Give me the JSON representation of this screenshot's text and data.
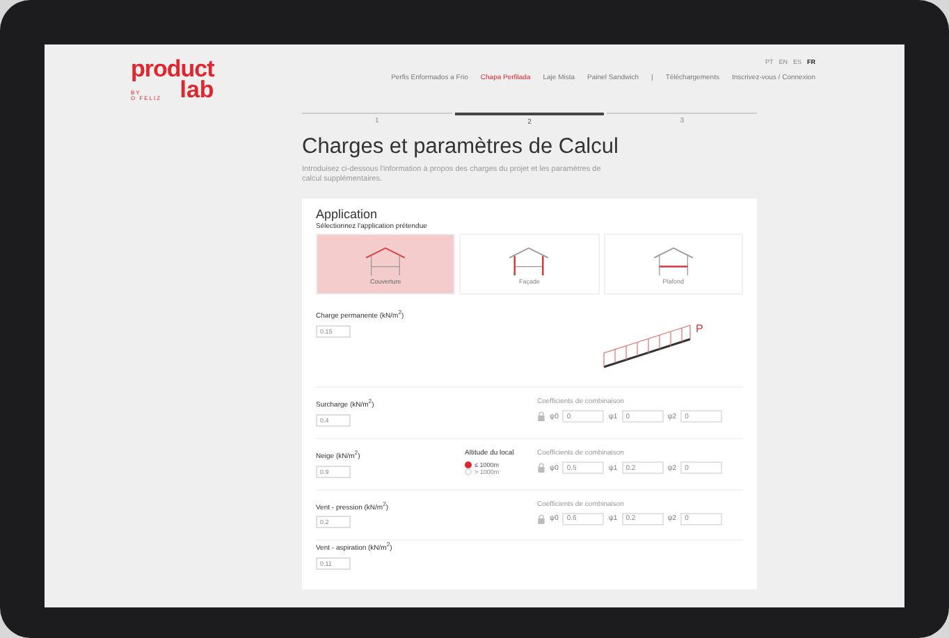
{
  "languages": [
    {
      "label": "PT",
      "selected": false
    },
    {
      "label": "EN",
      "selected": false
    },
    {
      "label": "ES",
      "selected": false
    },
    {
      "label": "FR",
      "selected": true
    }
  ],
  "logo": {
    "top": "product",
    "by": "BY",
    "brand": "O FELIZ",
    "bottom": "lab"
  },
  "nav": [
    {
      "label": "Perfis Enformados a Frio",
      "selected": false
    },
    {
      "label": "Chapa Perfilada",
      "selected": true
    },
    {
      "label": "Laje Mista",
      "selected": false
    },
    {
      "label": "Painel Sandwich",
      "selected": false
    },
    {
      "label": "|",
      "selected": false
    },
    {
      "label": "Téléchargements",
      "selected": false
    },
    {
      "label": "Inscrivez-vous / Connexion",
      "selected": false
    }
  ],
  "steps": [
    {
      "label": "1",
      "selected": false
    },
    {
      "label": "2",
      "selected": true
    },
    {
      "label": "3",
      "selected": false
    }
  ],
  "title": "Charges et paramètres de Calcul",
  "intro": "Introduisez ci-dessous l'information à propos des charges du projet et les paramètres de calcul supplémentaires.",
  "application": {
    "heading": "Application",
    "subheading": "Sélectionnez l'application prétendue",
    "options": [
      {
        "label": "Couverture",
        "kind": "roof",
        "selected": true
      },
      {
        "label": "Façade",
        "kind": "walls",
        "selected": false
      },
      {
        "label": "Plafond",
        "kind": "floor",
        "selected": false
      }
    ]
  },
  "permanent": {
    "label": "Charge permanente (kN/m$^{2}$)",
    "value": "0.15",
    "diagram_label": "P"
  },
  "loads": [
    {
      "label": "Surcharge (kN/m$^{2}$)",
      "value": "0.4",
      "coefficients": {
        "title": "Coefficients de combinaison",
        "locked": true,
        "items": [
          {
            "symbol": "ψ0",
            "value": "0"
          },
          {
            "symbol": "ψ1",
            "value": "0"
          },
          {
            "symbol": "ψ2",
            "value": "0"
          }
        ]
      }
    },
    {
      "label": "Neige (kN/m$^{2}$)",
      "value": "0.9",
      "altitude": {
        "title": "Altitude du local",
        "options": [
          {
            "label": "≤ 1000m",
            "selected": true
          },
          {
            "label": "> 1000m",
            "selected": false
          }
        ]
      },
      "coefficients": {
        "title": "Coefficients de combinaison",
        "locked": true,
        "items": [
          {
            "symbol": "ψ0",
            "value": "0.5"
          },
          {
            "symbol": "ψ1",
            "value": "0.2"
          },
          {
            "symbol": "ψ2",
            "value": "0"
          }
        ]
      }
    },
    {
      "label": "Vent - pression (kN/m$^{2}$)",
      "value": "0.2",
      "coefficients": {
        "title": "Coefficients de combinaison",
        "locked": true,
        "items": [
          {
            "symbol": "ψ0",
            "value": "0.6"
          },
          {
            "symbol": "ψ1",
            "value": "0.2"
          },
          {
            "symbol": "ψ2",
            "value": "0"
          }
        ]
      }
    },
    {
      "label": "Vent - aspiration (kN/m$^{2}$)",
      "value": "0.11"
    }
  ]
}
